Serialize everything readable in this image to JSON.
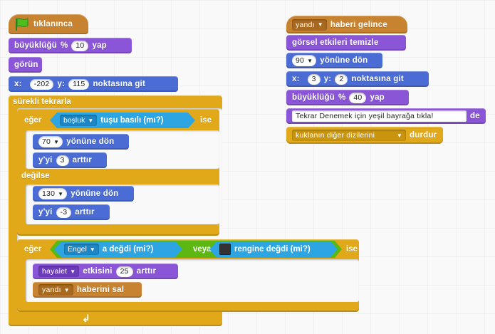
{
  "script_left": {
    "flag_hat": {
      "label": "tıklanınca",
      "icon": "green-flag-icon"
    },
    "set_size": {
      "pre": "büyüklüğü",
      "pct": "%",
      "value": "10",
      "post": "yap"
    },
    "show": {
      "label": "görün"
    },
    "goto_xy": {
      "x_label": "x:",
      "x": "-202",
      "y_label": "y:",
      "y": "115",
      "post": "noktasına git"
    },
    "forever": {
      "label": "sürekli tekrarla"
    },
    "if_else": {
      "if_label": "eğer",
      "key": "boşluk",
      "key_post": "tuşu basılı (mı?)",
      "is_label": "ise",
      "turn1": {
        "value": "70",
        "post": "yönüne dön"
      },
      "changey1": {
        "pre": "y'yi",
        "value": "3",
        "post": "arttır"
      },
      "else_label": "değilse",
      "turn2": {
        "value": "130",
        "post": "yönüne dön"
      },
      "changey2": {
        "pre": "y'yi",
        "value": "-3",
        "post": "arttır"
      }
    },
    "if2": {
      "if_label": "eğer",
      "touching_target": "Engel",
      "touching_post": "a değdi (mi?)",
      "or_label": "veya",
      "color_post": "rengine değdi (mi?)",
      "is_label": "ise",
      "touch_color": "#333333",
      "effect": {
        "target": "hayalet",
        "post": "etkisini",
        "value": "25",
        "post2": "arttır"
      },
      "broadcast": {
        "msg": "yandı",
        "post": "haberini sal"
      }
    },
    "loop_arrow": "↲"
  },
  "script_right": {
    "receive_hat": {
      "msg": "yandı",
      "post": "haberi gelince"
    },
    "clear_effects": {
      "label": "görsel etkileri temizle"
    },
    "point_dir": {
      "value": "90",
      "post": "yönüne dön"
    },
    "goto_xy": {
      "x_label": "x:",
      "x": "3",
      "y_label": "y:",
      "y": "2",
      "post": "noktasına git"
    },
    "set_size": {
      "pre": "büyüklüğü",
      "pct": "%",
      "value": "40",
      "post": "yap"
    },
    "say": {
      "text": "Tekrar Denemek için yeşil bayrağa tıkla!",
      "post": "de"
    },
    "stop": {
      "option": "kuklanın diğer dizilerini",
      "post": "durdur"
    }
  },
  "colors": {
    "events": "#c88330",
    "looks": "#8a55d7",
    "motion": "#4a6cd4",
    "control": "#e1a91a",
    "sensing": "#2ca5e2",
    "operators": "#5cb712"
  }
}
